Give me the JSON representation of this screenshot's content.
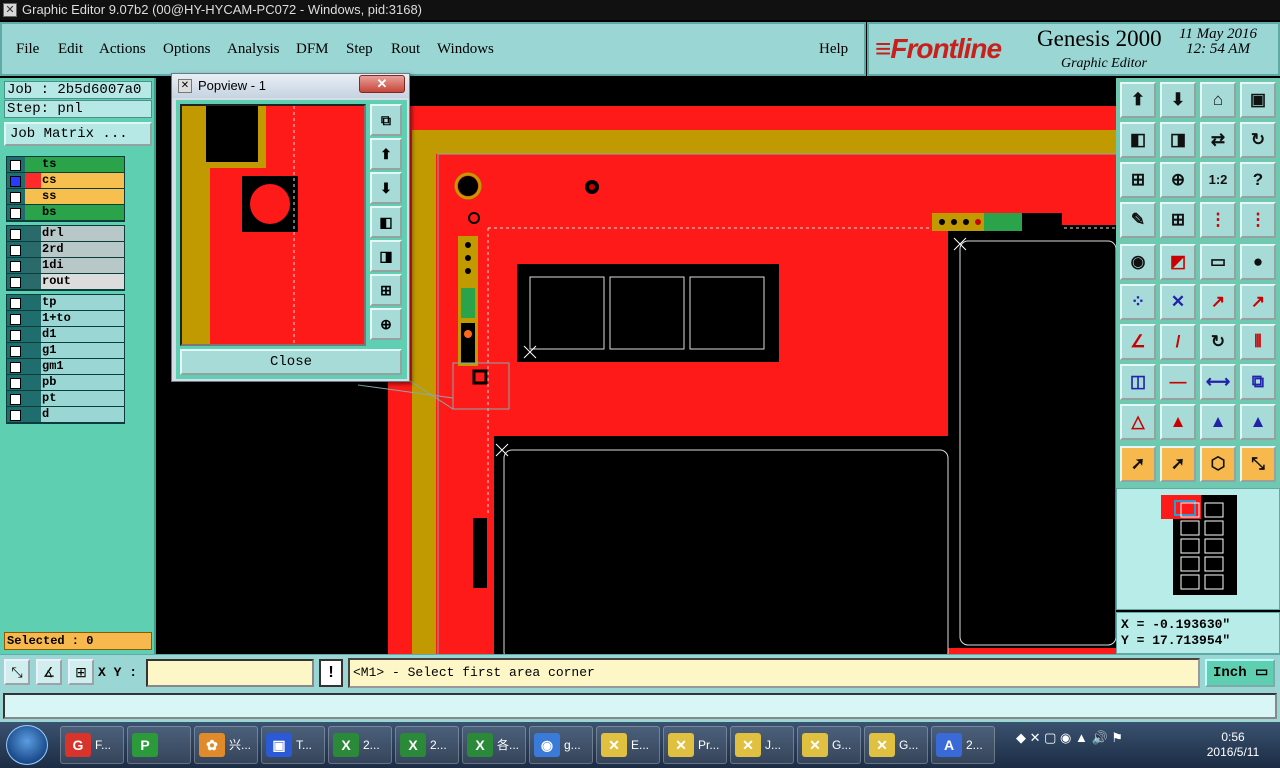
{
  "window": {
    "title": "Graphic Editor 9.07b2 (00@HY-HYCAM-PC072 - Windows, pid:3168)"
  },
  "menu": {
    "items": [
      "File",
      "Edit",
      "Actions",
      "Options",
      "Analysis",
      "DFM",
      "Step",
      "Rout",
      "Windows"
    ],
    "help": "Help"
  },
  "brand": {
    "logo_a": "Front",
    "logo_b": "line",
    "product": "Genesis 2000",
    "subtitle": "Graphic Editor",
    "date": "11 May 2016",
    "time": "12: 54  AM"
  },
  "job": {
    "job": "Job : 2b5d6007a0",
    "step": "Step: pnl",
    "job_matrix": "Job Matrix ..."
  },
  "layers": {
    "group1": [
      {
        "name": "ts",
        "color": "#2aa34a"
      },
      {
        "name": "cs",
        "color": "#ff2a2a"
      },
      {
        "name": "ss",
        "color": "#f7c04e"
      },
      {
        "name": "bs",
        "color": "#2aa34a"
      }
    ],
    "group2": [
      {
        "name": "drl"
      },
      {
        "name": "2rd"
      },
      {
        "name": "1di"
      },
      {
        "name": "rout"
      }
    ],
    "group3": [
      {
        "name": "tp"
      },
      {
        "name": "1+to"
      },
      {
        "name": "d1"
      },
      {
        "name": "g1"
      },
      {
        "name": "gm1"
      },
      {
        "name": "pb"
      },
      {
        "name": "pt"
      },
      {
        "name": "d"
      }
    ]
  },
  "selected": "Selected : 0",
  "coords": {
    "x": "X = -0.193630\"",
    "y": "Y = 17.713954\""
  },
  "status": {
    "xy_label": "X Y :",
    "xy_value": "",
    "excl": "!",
    "prompt": "<M1> - Select first area corner",
    "unit": "Inch"
  },
  "popview": {
    "title": "Popview - 1",
    "close": "Close"
  },
  "taskbar": {
    "tasks": [
      {
        "label": "F...",
        "icon": "G",
        "color": "#d8342c"
      },
      {
        "label": "",
        "icon": "P",
        "color": "#2b9a3a"
      },
      {
        "label": "兴...",
        "icon": "✿",
        "color": "#e08a2a"
      },
      {
        "label": "T...",
        "icon": "▣",
        "color": "#2a5ad8"
      },
      {
        "label": "2...",
        "icon": "X",
        "color": "#2a8a3a"
      },
      {
        "label": "2...",
        "icon": "X",
        "color": "#2a8a3a"
      },
      {
        "label": "各...",
        "icon": "X",
        "color": "#2a8a3a"
      },
      {
        "label": "g...",
        "icon": "◉",
        "color": "#3a7ad8"
      },
      {
        "label": "E...",
        "icon": "✕",
        "color": "#e0c040"
      },
      {
        "label": "Pr...",
        "icon": "✕",
        "color": "#e0c040"
      },
      {
        "label": "J...",
        "icon": "✕",
        "color": "#e0c040"
      },
      {
        "label": "G...",
        "icon": "✕",
        "color": "#e0c040"
      },
      {
        "label": "G...",
        "icon": "✕",
        "color": "#e0c040"
      },
      {
        "label": "2...",
        "icon": "A",
        "color": "#3a6ad8"
      }
    ],
    "time": "0:56",
    "date": "2016/5/11"
  },
  "colors": {
    "cs": "#ff1a1a",
    "ss": "#c09a00",
    "board": "#000000"
  }
}
